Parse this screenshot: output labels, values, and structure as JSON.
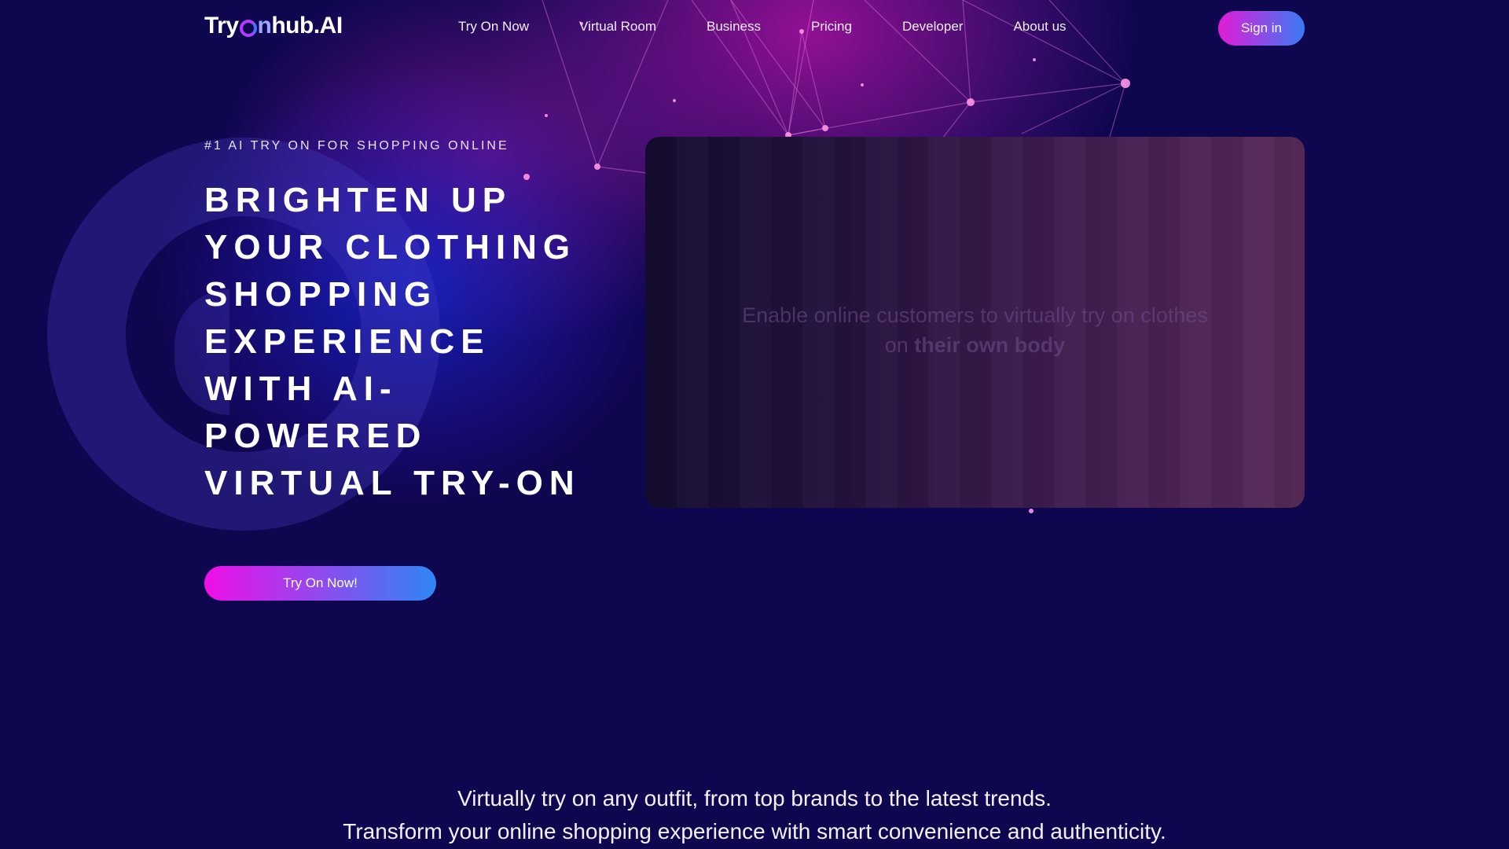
{
  "brand": {
    "logo_part1": "Try",
    "logo_part2": "n",
    "logo_part3": "hub.AI"
  },
  "nav": {
    "items": [
      {
        "label": "Try On Now"
      },
      {
        "label": "Virtual Room"
      },
      {
        "label": "Business"
      },
      {
        "label": "Pricing"
      },
      {
        "label": "Developer"
      },
      {
        "label": "About us"
      }
    ],
    "signin_label": "Sign in"
  },
  "hero": {
    "kicker": "#1 AI TRY ON FOR SHOPPING ONLINE",
    "headline_lines": [
      "BRIGHTEN UP",
      "YOUR CLOTHING",
      "SHOPPING",
      "EXPERIENCE",
      "WITH AI-",
      "POWERED",
      "VIRTUAL TRY-ON"
    ],
    "cta_label": "Try On Now!"
  },
  "video": {
    "caption_part1": "Enable online customers to virtually try on clothes on ",
    "caption_emphasis": "their own body"
  },
  "tagline": {
    "line1": "Virtually try on any outfit, from top brands to the latest trends.",
    "line2": "Transform your online shopping experience with smart convenience and authenticity."
  },
  "colors": {
    "background": "#0f0650",
    "accent_pink": "#e21bd6",
    "accent_blue": "#3a7bf5"
  }
}
